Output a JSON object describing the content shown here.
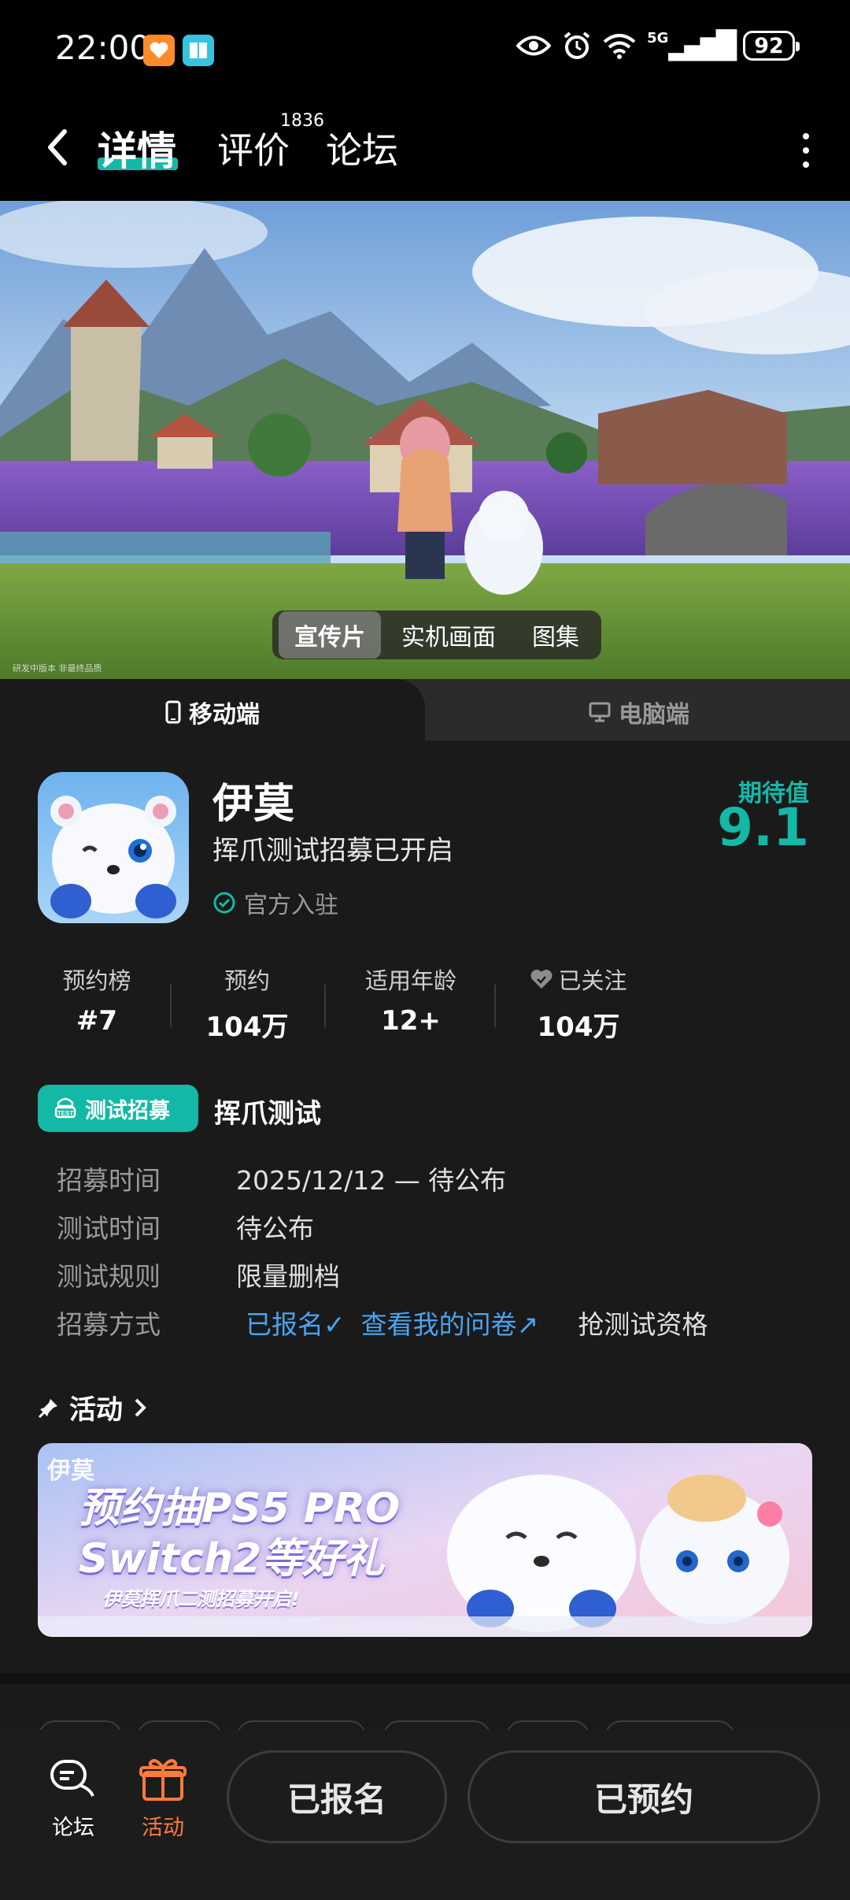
{
  "status_bar": {
    "time": "22:00",
    "network": "5G",
    "battery": "92"
  },
  "nav": {
    "tabs": [
      {
        "label": "详情",
        "active": true
      },
      {
        "label": "评价",
        "count": "1836"
      },
      {
        "label": "论坛"
      }
    ]
  },
  "hero": {
    "tabs": [
      "宣传片",
      "实机画面",
      "图集"
    ],
    "active_tab": "宣传片",
    "note": "研发中版本 非最终品质"
  },
  "platforms": {
    "mobile": "移动端",
    "pc": "电脑端",
    "active": "移动端"
  },
  "game": {
    "name": "伊莫",
    "subtitle": "挥爪测试招募已开启",
    "official": "官方入驻",
    "expect_label": "期待值",
    "expect_value": "9.1"
  },
  "stats": [
    {
      "label": "预约榜",
      "value": "#7"
    },
    {
      "label": "预约",
      "value": "104万"
    },
    {
      "label": "适用年龄",
      "value": "12+"
    },
    {
      "label": "已关注",
      "value": "104万"
    }
  ],
  "test": {
    "badge": "测试招募",
    "title": "挥爪测试",
    "rows": [
      {
        "key": "招募时间",
        "value": "2025/12/12 — 待公布"
      },
      {
        "key": "测试时间",
        "value": "待公布"
      },
      {
        "key": "测试规则",
        "value": "限量删档"
      }
    ],
    "method_key": "招募方式",
    "signed_up": "已报名",
    "questionnaire": "查看我的问卷",
    "grab": "抢测试资格"
  },
  "activity": {
    "title": "活动",
    "banner_logo": "伊莫",
    "banner_line1": "预约抽PS5 PRO",
    "banner_line2": "Switch2等好礼",
    "banner_line3": "伊莫挥爪二测招募开启!"
  },
  "bottom": {
    "forum": "论坛",
    "activity": "活动",
    "signed_btn": "已报名",
    "reserved_btn": "已预约"
  },
  "colors": {
    "accent": "#14b8a6",
    "link": "#4aa3f0",
    "activity_orange": "#ff7a3d"
  }
}
